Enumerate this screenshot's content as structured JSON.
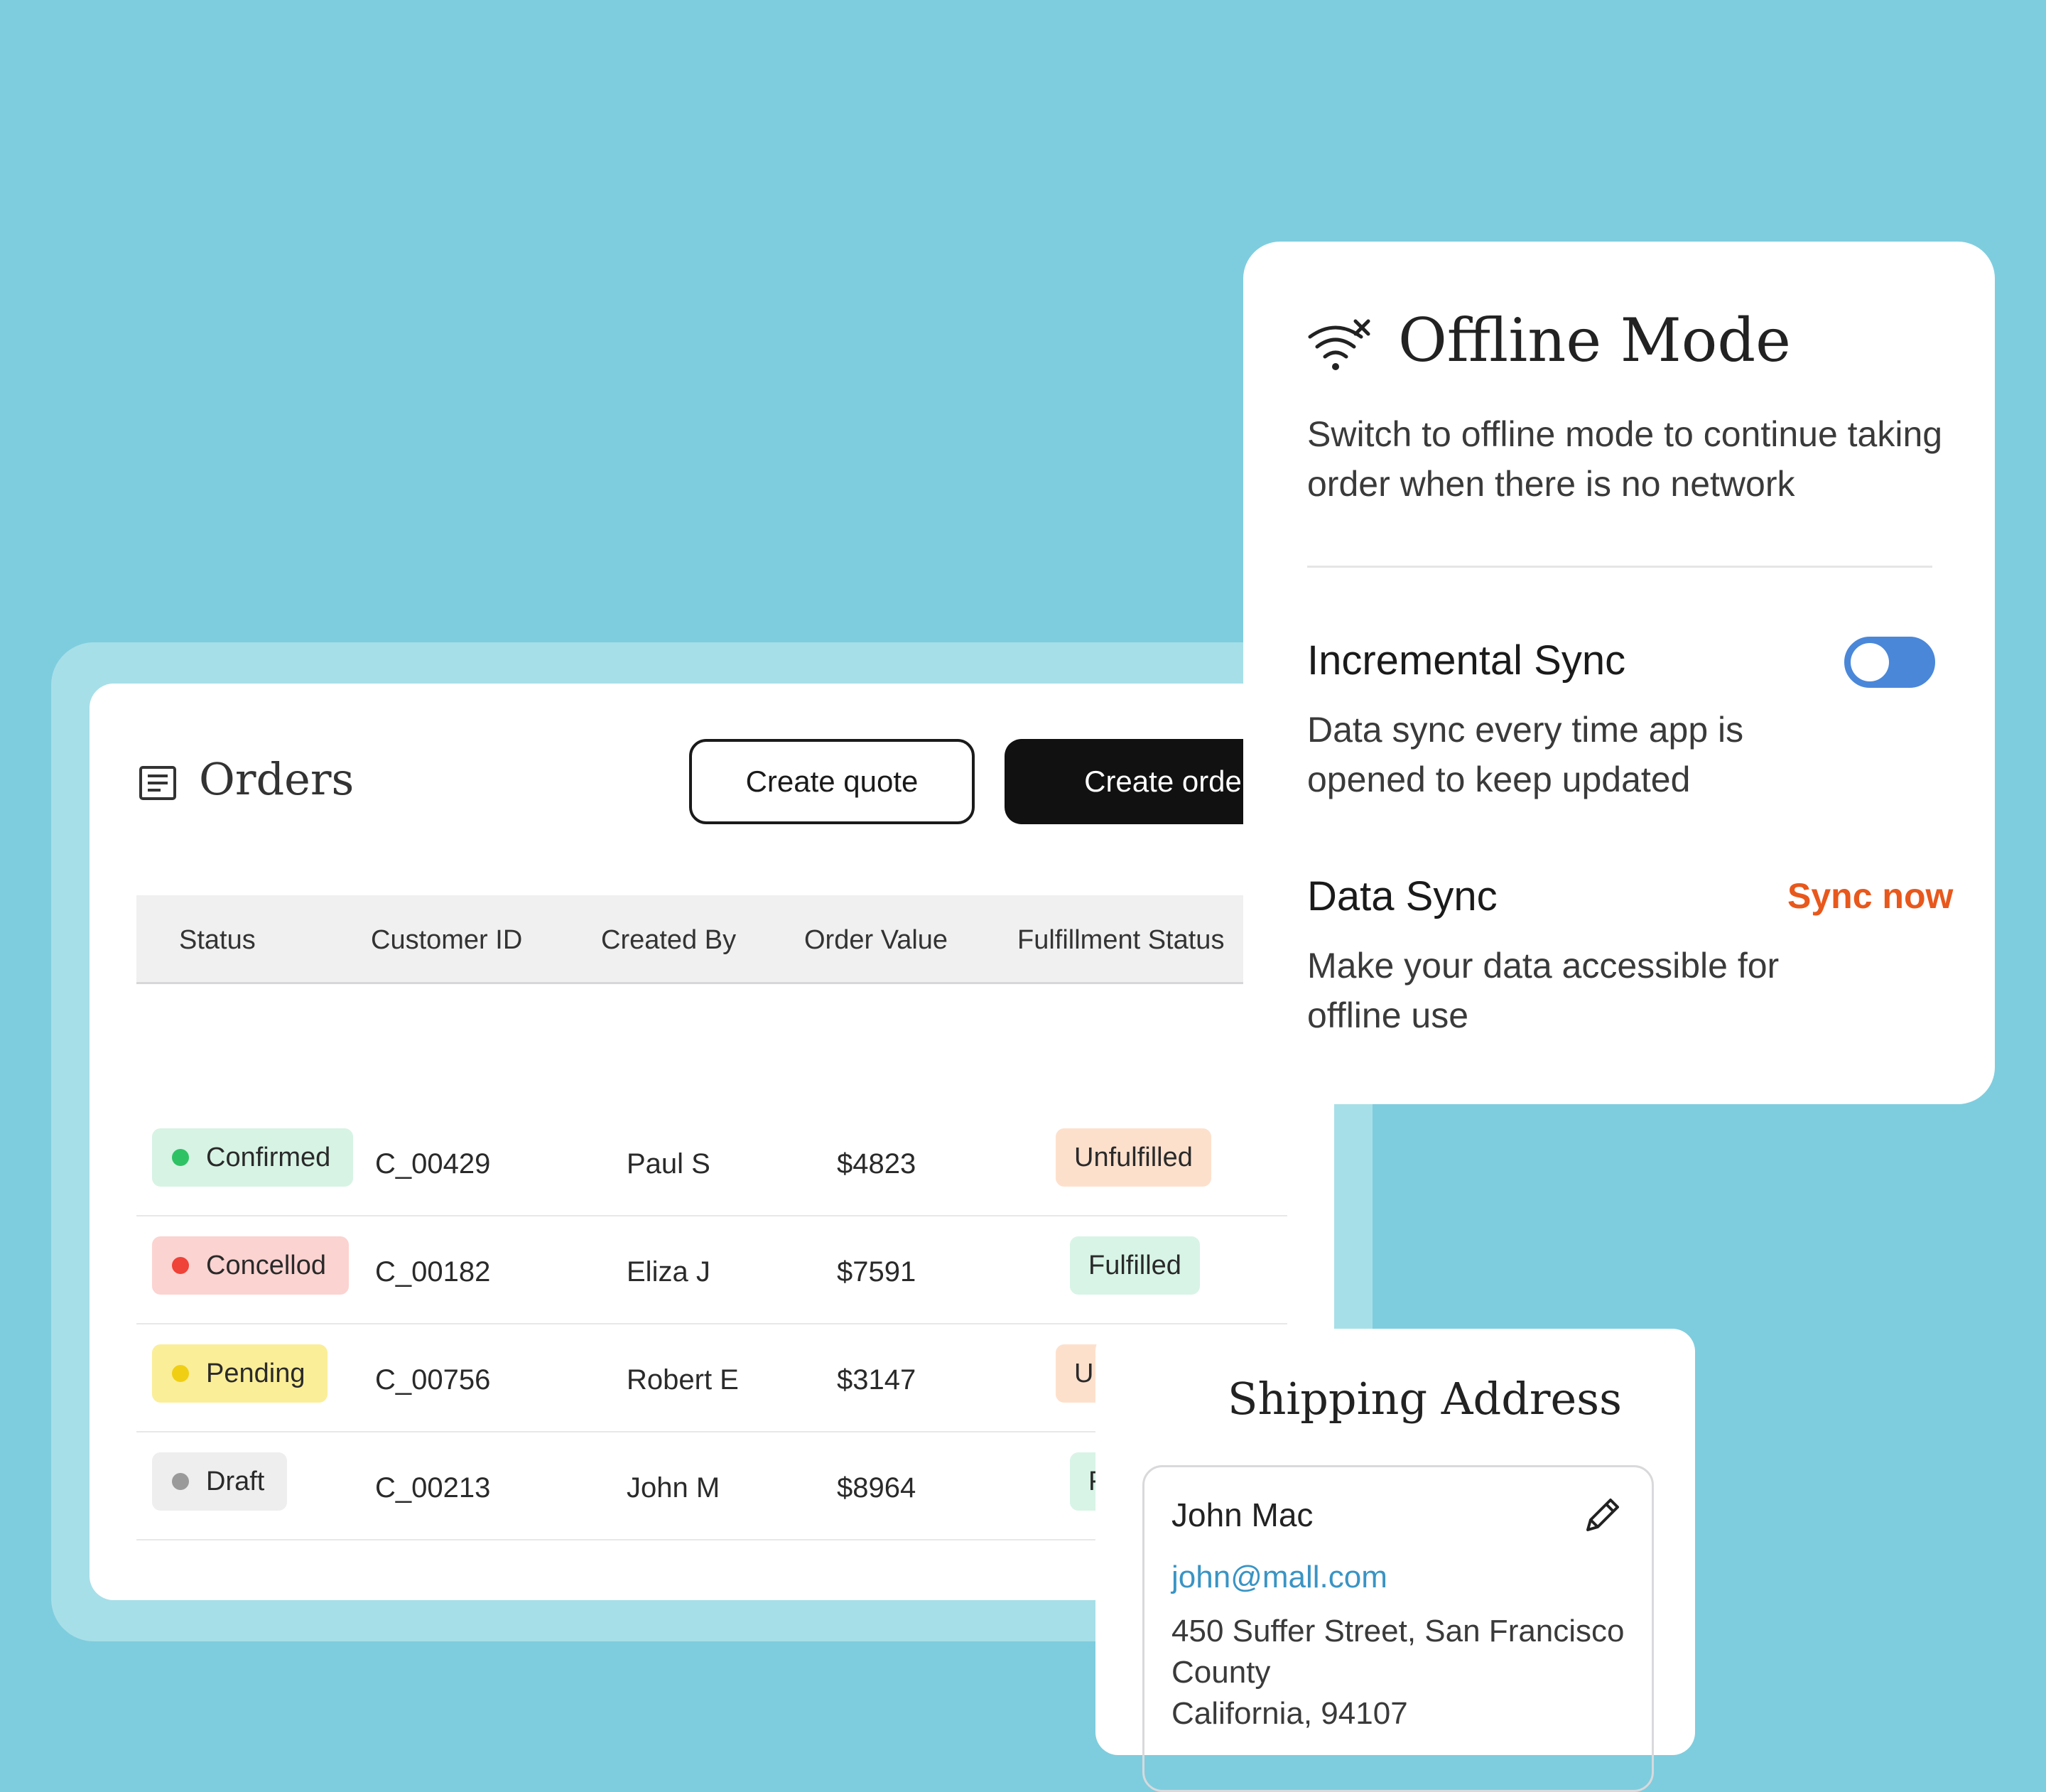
{
  "orders": {
    "title": "Orders",
    "create_quote_label": "Create quote",
    "create_order_label": "Create order",
    "columns": [
      "Status",
      "Customer ID",
      "Created By",
      "Order Value",
      "Fulfillment Status"
    ],
    "rows": [
      {
        "status": "Confirmed",
        "customer_id": "C_00429",
        "created_by": "Paul S",
        "order_value": "$4823",
        "fulfillment": "Unfulfilled"
      },
      {
        "status": "Concellod",
        "customer_id": "C_00182",
        "created_by": "Eliza J",
        "order_value": "$7591",
        "fulfillment": "Fulfilled"
      },
      {
        "status": "Pending",
        "customer_id": "C_00756",
        "created_by": "Robert E",
        "order_value": "$3147",
        "fulfillment": "Ur"
      },
      {
        "status": "Draft",
        "customer_id": "C_00213",
        "created_by": "John M",
        "order_value": "$8964",
        "fulfillment": "F"
      }
    ]
  },
  "offline": {
    "title": "Offline Mode",
    "description": "Switch to offline mode to continue taking order when there is no network",
    "incremental_sync": {
      "title": "Incremental Sync",
      "description": "Data sync every time app is opened to keep updated",
      "enabled": true
    },
    "data_sync": {
      "title": "Data Sync",
      "action_label": "Sync now",
      "description": "Make your data accessible for offline use"
    }
  },
  "shipping": {
    "title": "Shipping Address",
    "name": "John Mac",
    "email": "john@mall.com",
    "address_line1": "450 Suffer Street, San Francisco County",
    "address_line2": "California, 94107"
  },
  "colors": {
    "background": "#7ecdde",
    "accent_blue": "#4a87d9",
    "sync_orange": "#e8581c",
    "email_blue": "#3a94c4",
    "confirmed_bg": "#d7f3e4",
    "confirmed_dot": "#2fc265",
    "cancelled_bg": "#fbd3d1",
    "cancelled_dot": "#ef4238",
    "pending_bg": "#fbee98",
    "pending_dot": "#f0ce14",
    "draft_bg": "#eeeeee",
    "draft_dot": "#9a9a9a",
    "unfulfilled_bg": "#fde0cc",
    "fulfilled_bg": "#d8f4e6"
  },
  "icons": {
    "orders": "receipt-list-icon",
    "offline": "wifi-off-icon",
    "edit": "pencil-icon"
  }
}
